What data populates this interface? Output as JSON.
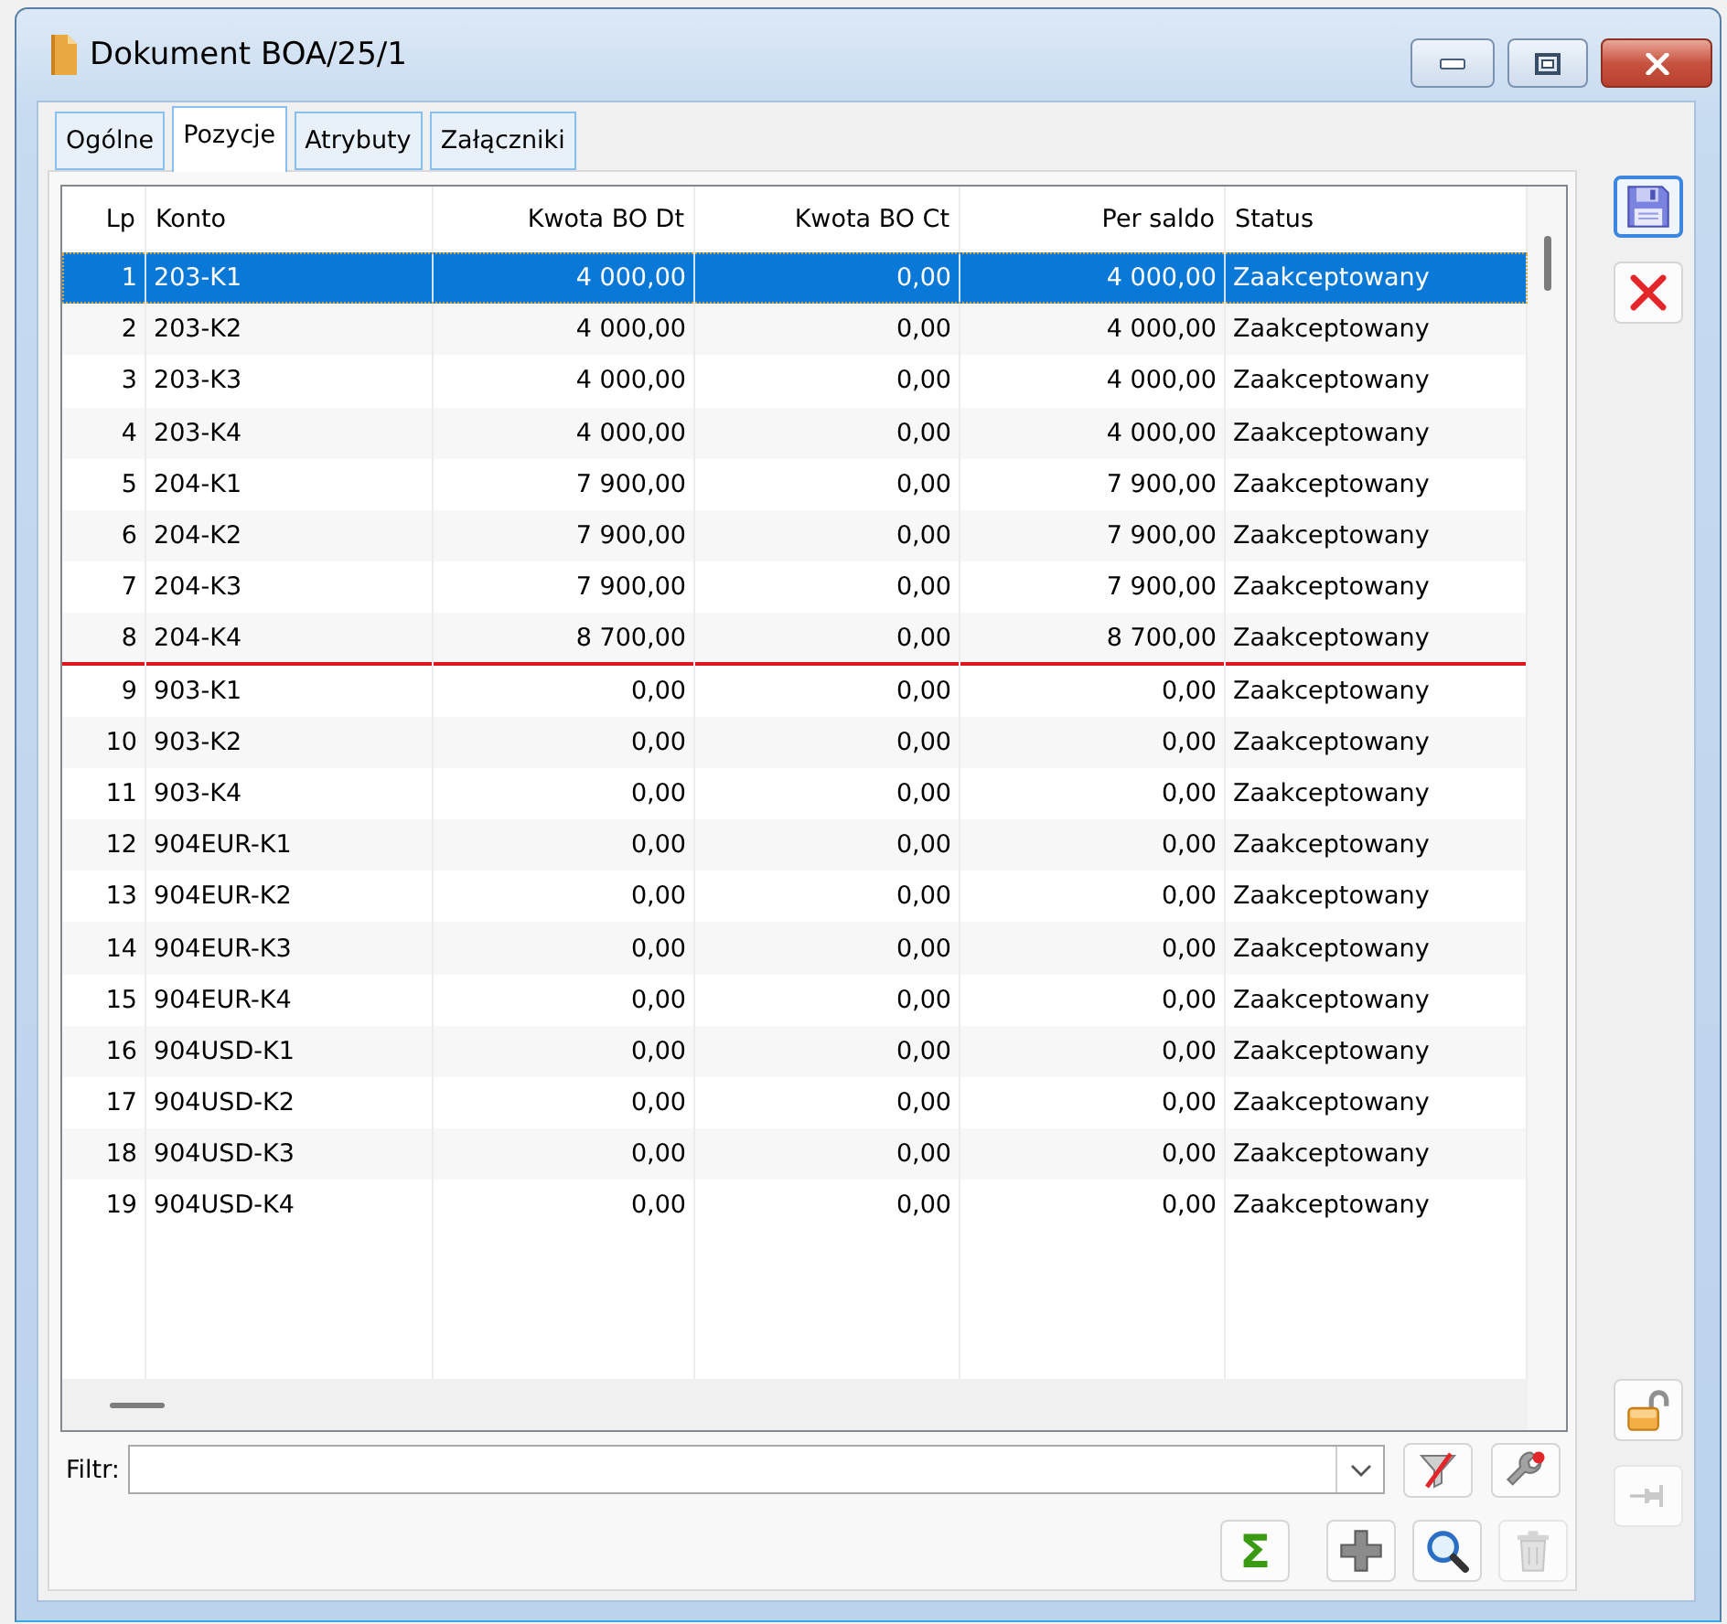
{
  "window": {
    "title": "Dokument BOA/25/1"
  },
  "tabs": [
    {
      "label": "Ogólne",
      "selected": false
    },
    {
      "label": "Pozycje",
      "selected": true
    },
    {
      "label": "Atrybuty",
      "selected": false
    },
    {
      "label": "Załączniki",
      "selected": false
    }
  ],
  "table": {
    "columns": [
      "Lp",
      "Konto",
      "Kwota BO Dt",
      "Kwota BO Ct",
      "Per saldo",
      "Status"
    ],
    "rows": [
      {
        "cells": [
          "1",
          "203-K1",
          "4 000,00",
          "0,00",
          "4 000,00",
          "Zaakceptowany"
        ],
        "selected": true,
        "line_below": false
      },
      {
        "cells": [
          "2",
          "203-K2",
          "4 000,00",
          "0,00",
          "4 000,00",
          "Zaakceptowany"
        ],
        "selected": false,
        "line_below": false
      },
      {
        "cells": [
          "3",
          "203-K3",
          "4 000,00",
          "0,00",
          "4 000,00",
          "Zaakceptowany"
        ],
        "selected": false,
        "line_below": false
      },
      {
        "cells": [
          "4",
          "203-K4",
          "4 000,00",
          "0,00",
          "4 000,00",
          "Zaakceptowany"
        ],
        "selected": false,
        "line_below": false
      },
      {
        "cells": [
          "5",
          "204-K1",
          "7 900,00",
          "0,00",
          "7 900,00",
          "Zaakceptowany"
        ],
        "selected": false,
        "line_below": false
      },
      {
        "cells": [
          "6",
          "204-K2",
          "7 900,00",
          "0,00",
          "7 900,00",
          "Zaakceptowany"
        ],
        "selected": false,
        "line_below": false
      },
      {
        "cells": [
          "7",
          "204-K3",
          "7 900,00",
          "0,00",
          "7 900,00",
          "Zaakceptowany"
        ],
        "selected": false,
        "line_below": false
      },
      {
        "cells": [
          "8",
          "204-K4",
          "8 700,00",
          "0,00",
          "8 700,00",
          "Zaakceptowany"
        ],
        "selected": false,
        "line_below": true
      },
      {
        "cells": [
          "9",
          "903-K1",
          "0,00",
          "0,00",
          "0,00",
          "Zaakceptowany"
        ],
        "selected": false,
        "line_below": false
      },
      {
        "cells": [
          "10",
          "903-K2",
          "0,00",
          "0,00",
          "0,00",
          "Zaakceptowany"
        ],
        "selected": false,
        "line_below": false
      },
      {
        "cells": [
          "11",
          "903-K4",
          "0,00",
          "0,00",
          "0,00",
          "Zaakceptowany"
        ],
        "selected": false,
        "line_below": false
      },
      {
        "cells": [
          "12",
          "904EUR-K1",
          "0,00",
          "0,00",
          "0,00",
          "Zaakceptowany"
        ],
        "selected": false,
        "line_below": false
      },
      {
        "cells": [
          "13",
          "904EUR-K2",
          "0,00",
          "0,00",
          "0,00",
          "Zaakceptowany"
        ],
        "selected": false,
        "line_below": false
      },
      {
        "cells": [
          "14",
          "904EUR-K3",
          "0,00",
          "0,00",
          "0,00",
          "Zaakceptowany"
        ],
        "selected": false,
        "line_below": false
      },
      {
        "cells": [
          "15",
          "904EUR-K4",
          "0,00",
          "0,00",
          "0,00",
          "Zaakceptowany"
        ],
        "selected": false,
        "line_below": false
      },
      {
        "cells": [
          "16",
          "904USD-K1",
          "0,00",
          "0,00",
          "0,00",
          "Zaakceptowany"
        ],
        "selected": false,
        "line_below": false
      },
      {
        "cells": [
          "17",
          "904USD-K2",
          "0,00",
          "0,00",
          "0,00",
          "Zaakceptowany"
        ],
        "selected": false,
        "line_below": false
      },
      {
        "cells": [
          "18",
          "904USD-K3",
          "0,00",
          "0,00",
          "0,00",
          "Zaakceptowany"
        ],
        "selected": false,
        "line_below": false
      },
      {
        "cells": [
          "19",
          "904USD-K4",
          "0,00",
          "0,00",
          "0,00",
          "Zaakceptowany"
        ],
        "selected": false,
        "line_below": false
      }
    ]
  },
  "filter": {
    "label": "Filtr:",
    "buttons": [
      {
        "kind": "clear-filter",
        "disabled": false
      },
      {
        "kind": "filter-settings",
        "disabled": false
      }
    ]
  },
  "toolbar": [
    {
      "kind": "sum",
      "label": "Σ",
      "disabled": false
    },
    {
      "kind": "add",
      "disabled": false
    },
    {
      "kind": "preview",
      "disabled": false
    },
    {
      "kind": "delete",
      "disabled": true
    }
  ],
  "side_buttons": [
    {
      "kind": "save",
      "focused": true,
      "disabled": false
    },
    {
      "kind": "cancel",
      "focused": false,
      "disabled": false
    },
    {
      "kind": "unlock",
      "focused": false,
      "disabled": false
    },
    {
      "kind": "pin",
      "focused": false,
      "disabled": true
    }
  ]
}
